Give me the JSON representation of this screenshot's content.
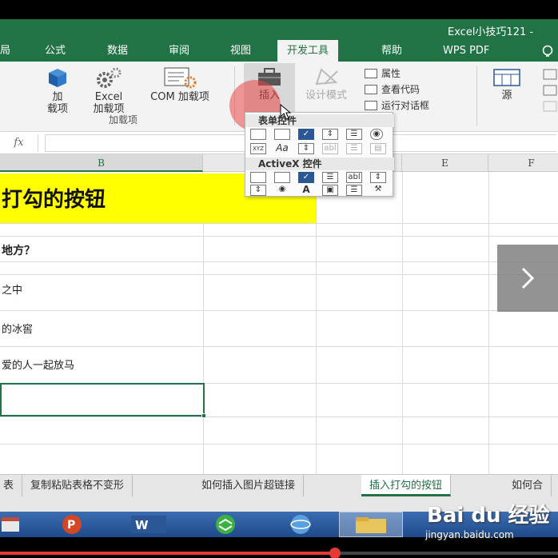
{
  "window": {
    "title": "Excel小技巧121 -"
  },
  "ribbon_tabs": [
    {
      "label": "局"
    },
    {
      "label": "公式"
    },
    {
      "label": "数据"
    },
    {
      "label": "审阅"
    },
    {
      "label": "视图"
    },
    {
      "label": "开发工具"
    },
    {
      "label": "帮助"
    },
    {
      "label": "WPS PDF"
    }
  ],
  "ribbon": {
    "addins_btn1": "加",
    "addins_btn1b": "载项",
    "excel_addins_1": "Excel",
    "excel_addins_2": "加载项",
    "com_addins": "COM 加载项",
    "group_addins": "加载项",
    "insert": "插入",
    "design_mode": "设计模式",
    "properties": "属性",
    "view_code": "查看代码",
    "run_dialog": "运行对话框",
    "source": "源"
  },
  "formula_bar": {
    "fx": "fx",
    "value": ""
  },
  "columns": [
    "B",
    "E",
    "F"
  ],
  "cells": {
    "title": "打勾的按钮",
    "row_question": "地方？",
    "row_a": "之中",
    "row_b": "的冰窖",
    "row_c": "爱的人一起放马"
  },
  "popup": {
    "form_controls": "表单控件",
    "activex_controls": "ActiveX 控件",
    "label_aa": "Aa",
    "label_abl": "abl",
    "label_a": "A",
    "label_xyz": "XYZ"
  },
  "sheet_tabs": [
    {
      "label": "表"
    },
    {
      "label": "复制粘贴表格不变形"
    },
    {
      "label": "如何插入图片超链接"
    },
    {
      "label": "插入打勾的按钮"
    },
    {
      "label": "如何合"
    }
  ],
  "watermark": {
    "logo": "Bai du 经验",
    "url": "jingyan.baidu.com"
  },
  "progress": {
    "fraction": 0.6
  },
  "colors": {
    "excel_green": "#217346",
    "highlight_yellow": "#ffff00",
    "click_red": "#eb4646"
  }
}
